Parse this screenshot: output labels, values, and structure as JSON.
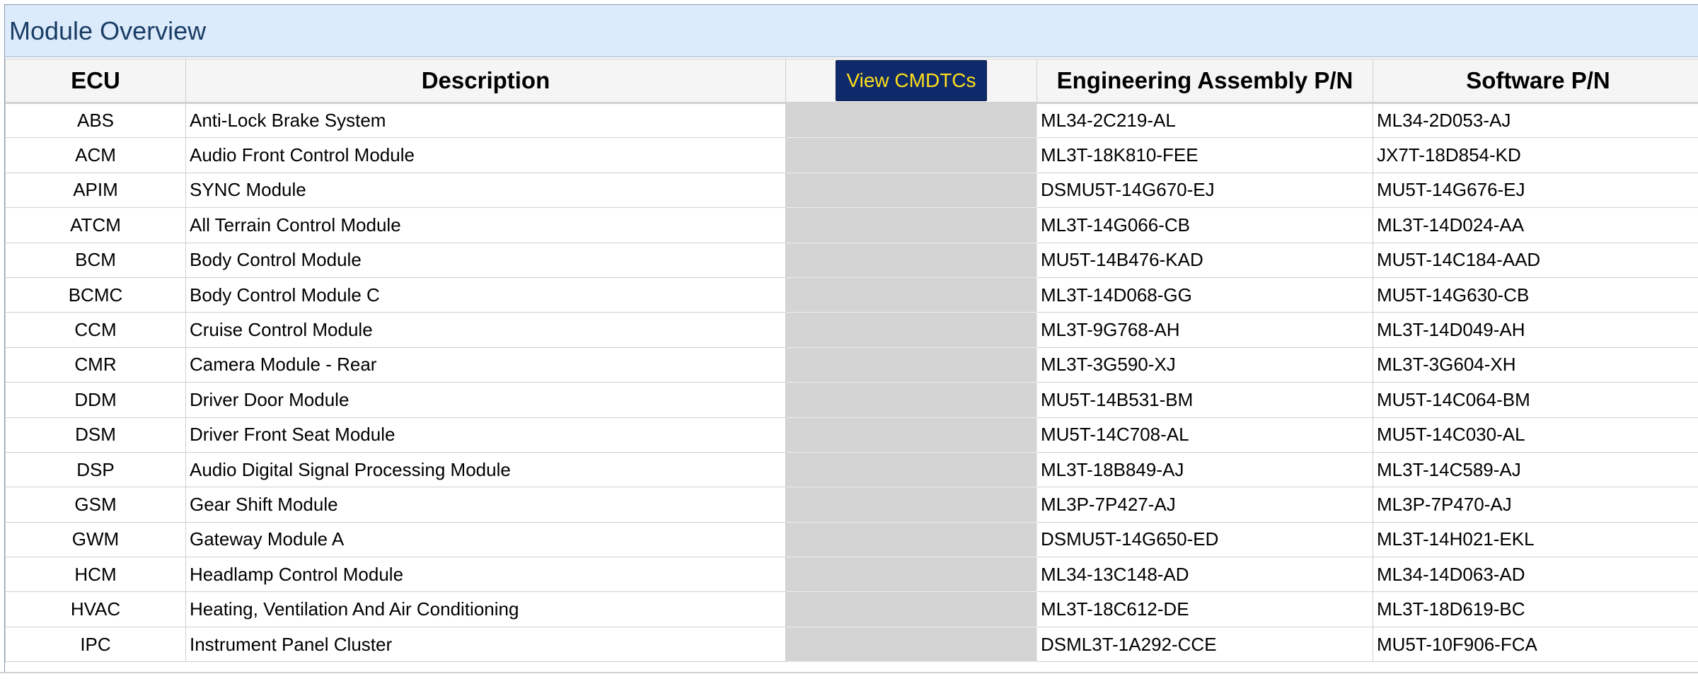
{
  "panel": {
    "title": "Module Overview"
  },
  "table": {
    "headers": {
      "ecu": "ECU",
      "description": "Description",
      "view_cmdtcs_button": "View CMDTCs",
      "engineering_pn": "Engineering Assembly P/N",
      "software_pn": "Software P/N"
    },
    "rows": [
      {
        "ecu": "ABS",
        "description": "Anti-Lock Brake System",
        "engineering_pn": "ML34-2C219-AL",
        "software_pn": "ML34-2D053-AJ"
      },
      {
        "ecu": "ACM",
        "description": "Audio Front Control Module",
        "engineering_pn": "ML3T-18K810-FEE",
        "software_pn": "JX7T-18D854-KD"
      },
      {
        "ecu": "APIM",
        "description": "SYNC Module",
        "engineering_pn": "DSMU5T-14G670-EJ",
        "software_pn": "MU5T-14G676-EJ"
      },
      {
        "ecu": "ATCM",
        "description": "All Terrain Control Module",
        "engineering_pn": "ML3T-14G066-CB",
        "software_pn": "ML3T-14D024-AA"
      },
      {
        "ecu": "BCM",
        "description": "Body Control Module",
        "engineering_pn": "MU5T-14B476-KAD",
        "software_pn": "MU5T-14C184-AAD"
      },
      {
        "ecu": "BCMC",
        "description": "Body Control Module C",
        "engineering_pn": "ML3T-14D068-GG",
        "software_pn": "MU5T-14G630-CB"
      },
      {
        "ecu": "CCM",
        "description": "Cruise Control Module",
        "engineering_pn": "ML3T-9G768-AH",
        "software_pn": "ML3T-14D049-AH"
      },
      {
        "ecu": "CMR",
        "description": "Camera Module - Rear",
        "engineering_pn": "ML3T-3G590-XJ",
        "software_pn": "ML3T-3G604-XH"
      },
      {
        "ecu": "DDM",
        "description": "Driver Door Module",
        "engineering_pn": "MU5T-14B531-BM",
        "software_pn": "MU5T-14C064-BM"
      },
      {
        "ecu": "DSM",
        "description": "Driver Front Seat Module",
        "engineering_pn": "MU5T-14C708-AL",
        "software_pn": "MU5T-14C030-AL"
      },
      {
        "ecu": "DSP",
        "description": "Audio Digital Signal Processing Module",
        "engineering_pn": "ML3T-18B849-AJ",
        "software_pn": "ML3T-14C589-AJ"
      },
      {
        "ecu": "GSM",
        "description": "Gear Shift Module",
        "engineering_pn": "ML3P-7P427-AJ",
        "software_pn": "ML3P-7P470-AJ"
      },
      {
        "ecu": "GWM",
        "description": "Gateway Module A",
        "engineering_pn": "DSMU5T-14G650-ED",
        "software_pn": "ML3T-14H021-EKL"
      },
      {
        "ecu": "HCM",
        "description": "Headlamp Control Module",
        "engineering_pn": "ML34-13C148-AD",
        "software_pn": "ML34-14D063-AD"
      },
      {
        "ecu": "HVAC",
        "description": "Heating, Ventilation And Air Conditioning",
        "engineering_pn": "ML3T-18C612-DE",
        "software_pn": "ML3T-18D619-BC"
      },
      {
        "ecu": "IPC",
        "description": "Instrument Panel Cluster",
        "engineering_pn": "DSML3T-1A292-CCE",
        "software_pn": "MU5T-10F906-FCA"
      }
    ]
  }
}
